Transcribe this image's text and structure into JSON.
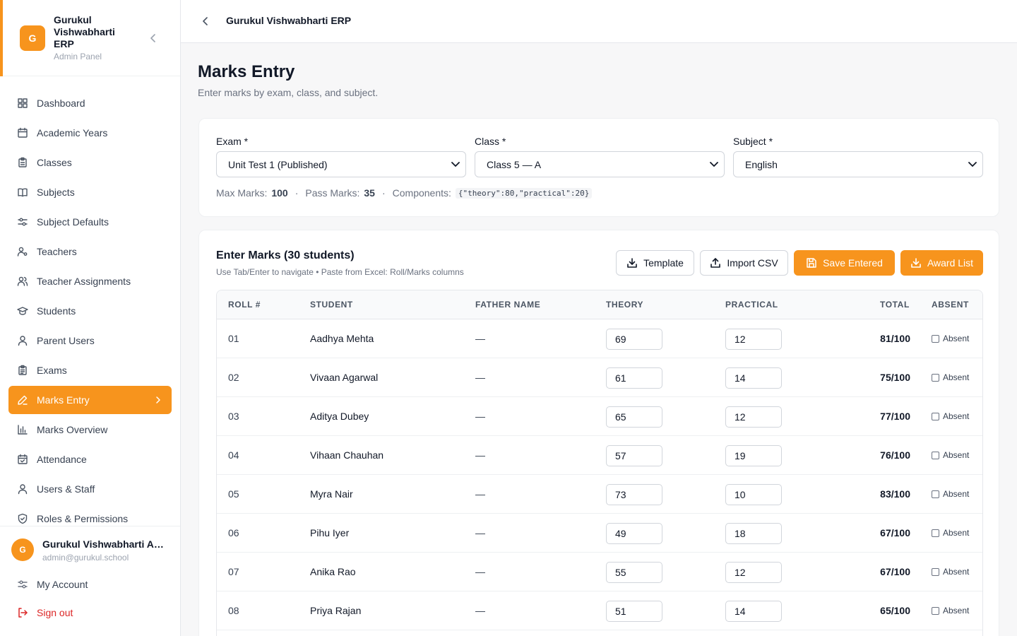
{
  "brand": {
    "logo_letter": "G",
    "name": "Gurukul Vishwabharti ERP",
    "subtitle": "Admin Panel"
  },
  "nav": [
    {
      "label": "Dashboard",
      "icon": "grid-icon"
    },
    {
      "label": "Academic Years",
      "icon": "calendar-icon"
    },
    {
      "label": "Classes",
      "icon": "clipboard-icon"
    },
    {
      "label": "Subjects",
      "icon": "book-icon"
    },
    {
      "label": "Subject Defaults",
      "icon": "sliders-icon"
    },
    {
      "label": "Teachers",
      "icon": "user-cog-icon"
    },
    {
      "label": "Teacher Assignments",
      "icon": "users-icon"
    },
    {
      "label": "Students",
      "icon": "graduation-cap-icon"
    },
    {
      "label": "Parent Users",
      "icon": "user-icon"
    },
    {
      "label": "Exams",
      "icon": "clipboard-list-icon"
    },
    {
      "label": "Marks Entry",
      "icon": "pencil-icon",
      "active": true
    },
    {
      "label": "Marks Overview",
      "icon": "bar-chart-icon"
    },
    {
      "label": "Attendance",
      "icon": "calendar-check-icon"
    },
    {
      "label": "Users & Staff",
      "icon": "user-icon"
    },
    {
      "label": "Roles & Permissions",
      "icon": "shield-icon"
    }
  ],
  "user": {
    "avatar_letter": "G",
    "name": "Gurukul Vishwabharti Admin",
    "email": "admin@gurukul.school"
  },
  "bottom_links": {
    "account": "My Account",
    "signout": "Sign out"
  },
  "topbar": {
    "title": "Gurukul Vishwabharti ERP"
  },
  "header": {
    "title": "Marks Entry",
    "subtitle": "Enter marks by exam, class, and subject."
  },
  "filters": {
    "exam_label": "Exam *",
    "exam_value": "Unit Test 1 (Published)",
    "class_label": "Class *",
    "class_value": "Class 5 — A",
    "subject_label": "Subject *",
    "subject_value": "English",
    "max_label": "Max Marks:",
    "max_value": "100",
    "pass_label": "Pass Marks:",
    "pass_value": "35",
    "components_label": "Components:",
    "components_value": "{\"theory\":80,\"practical\":20}",
    "sep": "·"
  },
  "marks": {
    "title": "Enter Marks (30 students)",
    "hint": "Use Tab/Enter to navigate • Paste from Excel: Roll/Marks columns",
    "btn_template": "Template",
    "btn_import": "Import CSV",
    "btn_save": "Save Entered",
    "btn_award": "Award List",
    "columns": [
      "ROLL #",
      "STUDENT",
      "FATHER NAME",
      "THEORY",
      "PRACTICAL",
      "TOTAL",
      "ABSENT"
    ],
    "absent_label": "Absent",
    "rows": [
      {
        "roll": "01",
        "student": "Aadhya Mehta",
        "father": "—",
        "theory": "69",
        "practical": "12",
        "total": "81/100"
      },
      {
        "roll": "02",
        "student": "Vivaan Agarwal",
        "father": "—",
        "theory": "61",
        "practical": "14",
        "total": "75/100"
      },
      {
        "roll": "03",
        "student": "Aditya Dubey",
        "father": "—",
        "theory": "65",
        "practical": "12",
        "total": "77/100"
      },
      {
        "roll": "04",
        "student": "Vihaan Chauhan",
        "father": "—",
        "theory": "57",
        "practical": "19",
        "total": "76/100"
      },
      {
        "roll": "05",
        "student": "Myra Nair",
        "father": "—",
        "theory": "73",
        "practical": "10",
        "total": "83/100"
      },
      {
        "roll": "06",
        "student": "Pihu Iyer",
        "father": "—",
        "theory": "49",
        "practical": "18",
        "total": "67/100"
      },
      {
        "roll": "07",
        "student": "Anika Rao",
        "father": "—",
        "theory": "55",
        "practical": "12",
        "total": "67/100"
      },
      {
        "roll": "08",
        "student": "Priya Rajan",
        "father": "—",
        "theory": "51",
        "practical": "14",
        "total": "65/100"
      }
    ]
  },
  "colors": {
    "accent": "#f7941d",
    "danger": "#dc2626"
  }
}
